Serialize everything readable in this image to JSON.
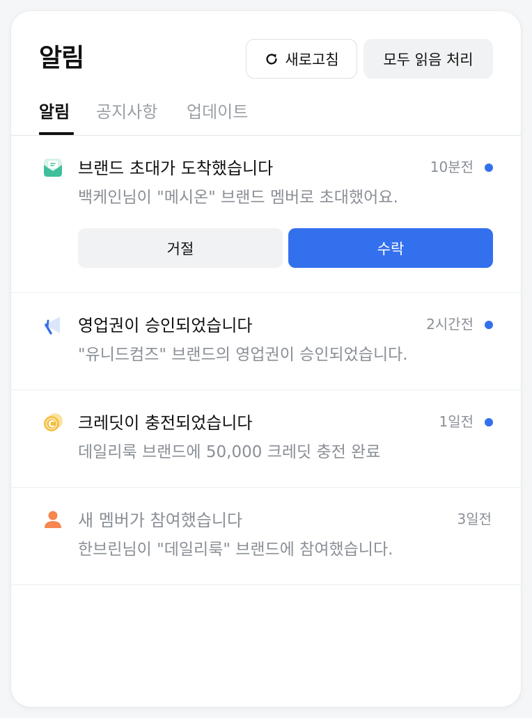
{
  "header": {
    "title": "알림",
    "refresh_label": "새로고침",
    "read_all_label": "모두 읽음 처리"
  },
  "tabs": [
    {
      "label": "알림",
      "active": true
    },
    {
      "label": "공지사항",
      "active": false
    },
    {
      "label": "업데이트",
      "active": false
    }
  ],
  "colors": {
    "accent": "#3370ee",
    "unread_dot": "#3370ee",
    "invite_icon": "#3fbf9b",
    "sales_icon": "#3a6fe6",
    "credit_icon": "#f5c043",
    "member_icon": "#f5874f"
  },
  "notifications": [
    {
      "icon": "envelope-invite-icon",
      "title": "브랜드 초대가 도착했습니다",
      "body": "백케인님이 \"메시온\" 브랜드 멤버로 초대했어요.",
      "time": "10분전",
      "unread": true,
      "actions": {
        "reject": "거절",
        "accept": "수락"
      }
    },
    {
      "icon": "megaphone-icon",
      "title": "영업권이 승인되었습니다",
      "body": "\"유니드컴즈\" 브랜드의 영업권이 승인되었습니다.",
      "time": "2시간전",
      "unread": true
    },
    {
      "icon": "credit-coin-icon",
      "title": "크레딧이 충전되었습니다",
      "body": "데일리룩 브랜드에 50,000 크레딧 충전 완료",
      "time": "1일전",
      "unread": true
    },
    {
      "icon": "person-icon",
      "title": "새 멤버가 참여했습니다",
      "body": "한브린님이 \"데일리룩\" 브랜드에 참여했습니다.",
      "time": "3일전",
      "unread": false
    }
  ]
}
